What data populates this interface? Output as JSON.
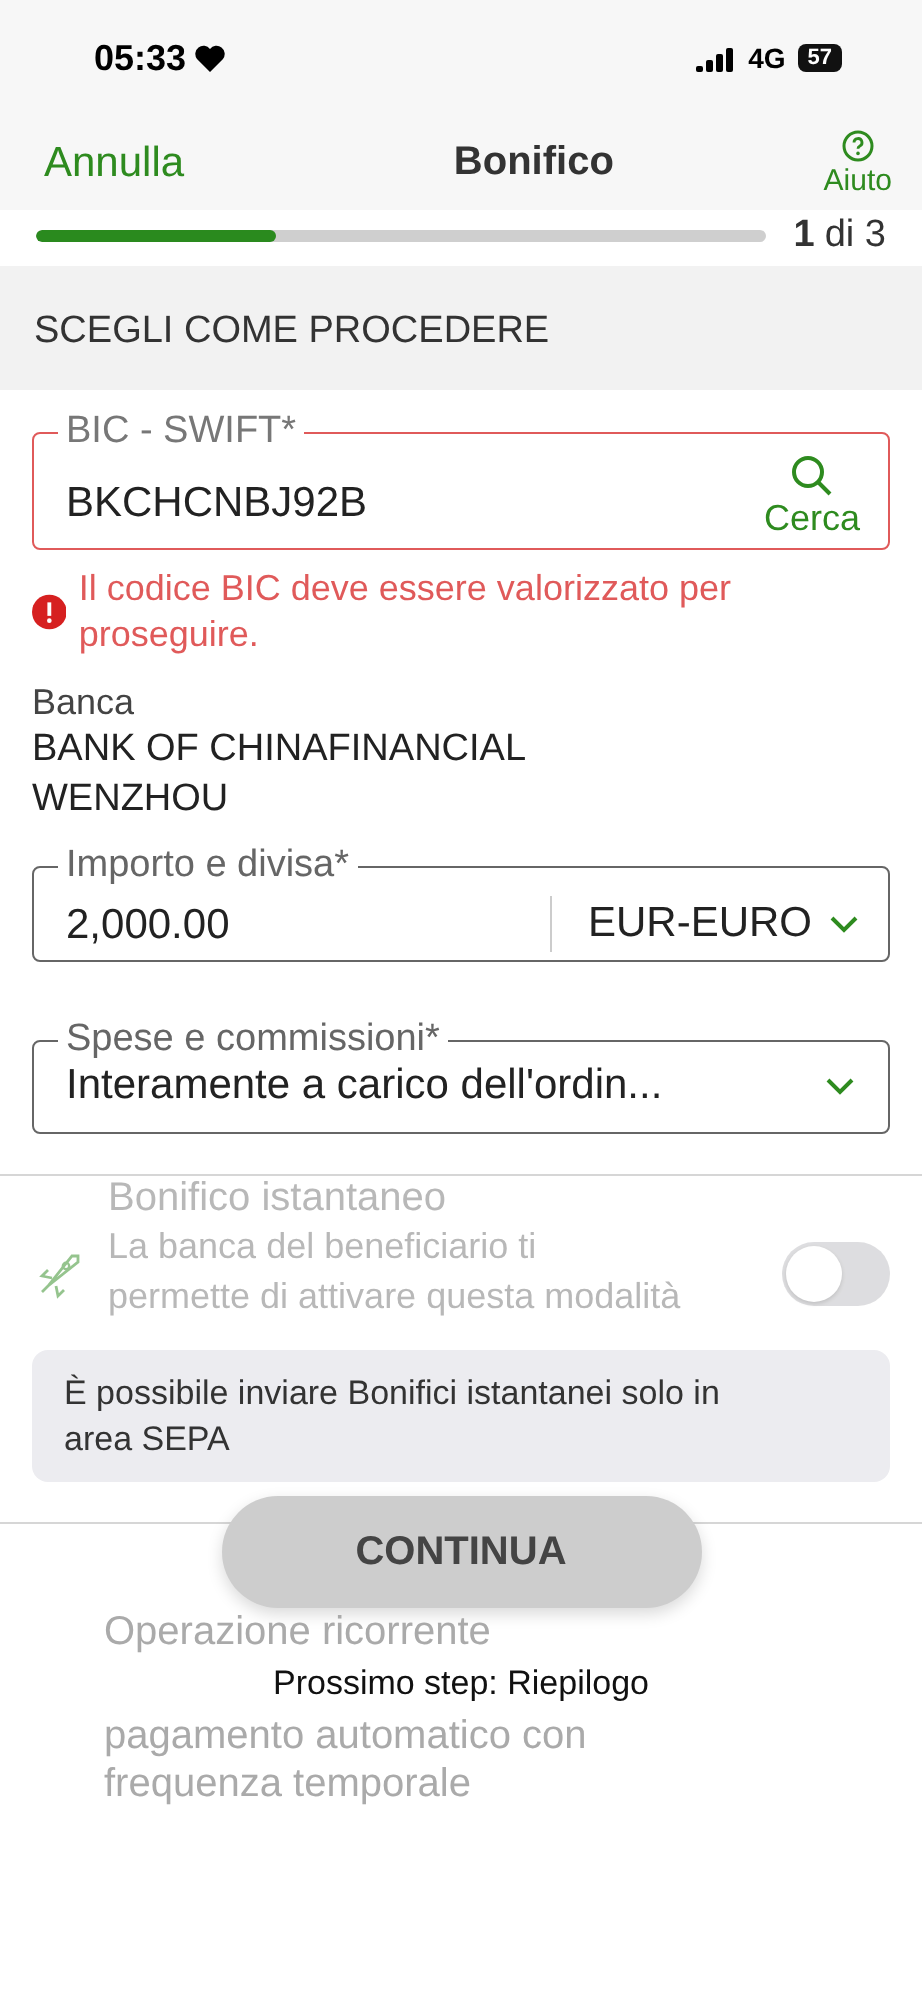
{
  "status_bar": {
    "time": "05:33",
    "network": "4G",
    "battery": "57"
  },
  "header": {
    "cancel": "Annulla",
    "title": "Bonifico",
    "help": "Aiuto"
  },
  "progress": {
    "level": 0.33,
    "current": "1",
    "total": "di 3"
  },
  "section_title": "SCEGLI COME PROCEDERE",
  "bic_field": {
    "label": "BIC - SWIFT*",
    "value": "BKCHCNBJ92B",
    "action": "Cerca",
    "error": true
  },
  "error_message": "Il codice BIC deve essere valorizzato per proseguire.",
  "bank": {
    "label": "Banca",
    "lines": [
      "BANK OF CHINAFINANCIAL",
      "WENZHOU"
    ]
  },
  "amount_field": {
    "label": "Importo e divisa*",
    "value": "2,000.00",
    "currency": "EUR-EURO"
  },
  "fees_field": {
    "label": "Spese e commissioni*",
    "value": "Interamente a carico dell'ordin..."
  },
  "instant_transfer": {
    "title": "Bonifico istantaneo",
    "description": "La banca del beneficiario ti permette di attivare questa modalità",
    "on": false,
    "disabled": true
  },
  "info_note": "È possibile inviare Bonifici istantanei solo in area SEPA",
  "continue_button": "CONTINUA",
  "recurring": {
    "title": "Operazione ricorrente",
    "lines": [
      "pagamento automatico con",
      "frequenza temporale"
    ]
  },
  "next_step": "Prossimo step: Riepilogo"
}
